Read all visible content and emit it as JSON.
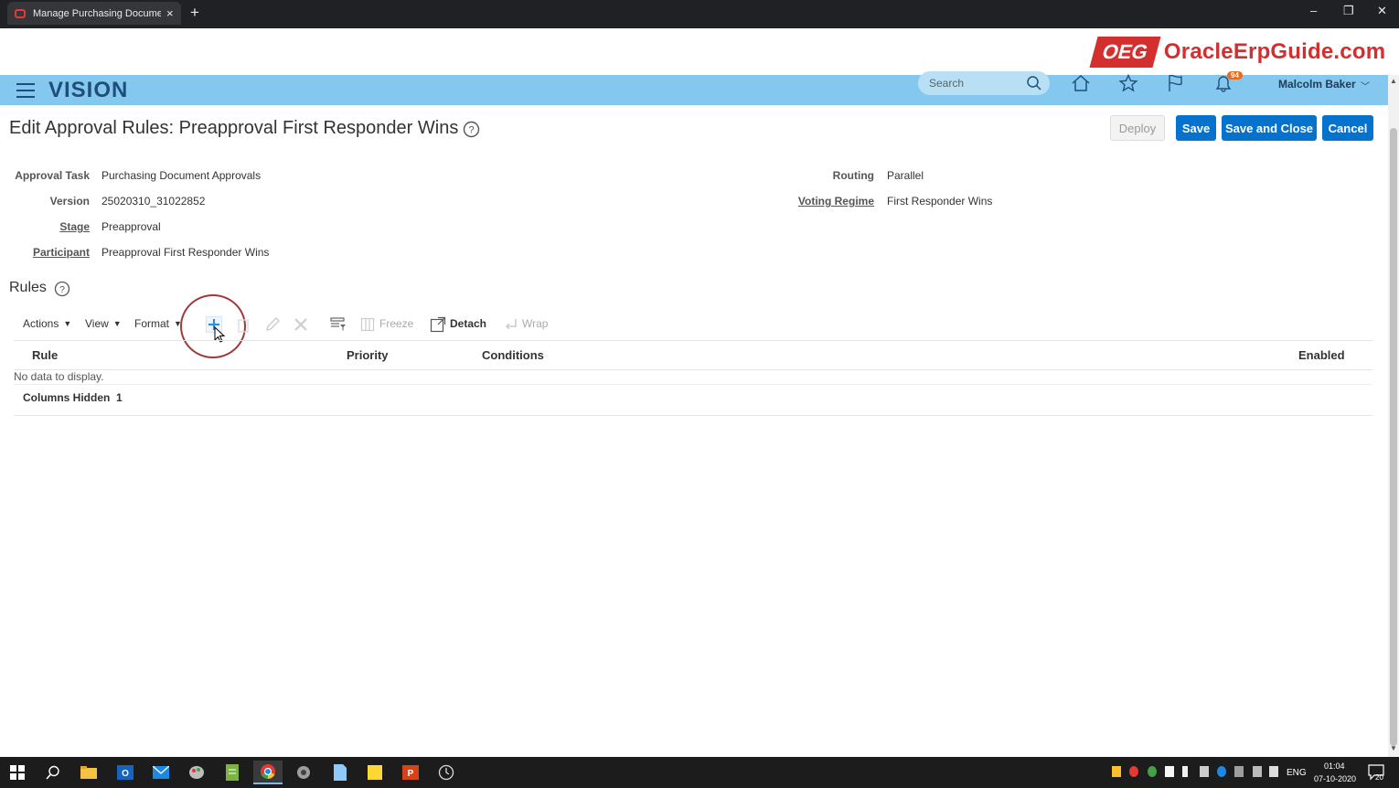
{
  "browser": {
    "tab_title": "Manage Purchasing Document A",
    "new_tab": "+",
    "close": "×",
    "minimize": "–",
    "restore": "❐",
    "window_close": "✕"
  },
  "brand": {
    "box": "OEG",
    "text": "OracleErpGuide.com"
  },
  "header": {
    "logo": "VISION",
    "search_placeholder": "Search",
    "notification_count": "94",
    "user_name": "Malcolm Baker"
  },
  "page": {
    "title": "Edit Approval Rules: Preapproval First Responder Wins",
    "buttons": {
      "deploy": "Deploy",
      "save": "Save",
      "save_close": "Save and Close",
      "cancel": "Cancel"
    }
  },
  "form": {
    "approval_task": {
      "label": "Approval Task",
      "value": "Purchasing Document Approvals"
    },
    "version": {
      "label": "Version",
      "value": "25020310_31022852"
    },
    "stage": {
      "label": "Stage",
      "value": "Preapproval"
    },
    "participant": {
      "label": "Participant",
      "value": "Preapproval First Responder Wins"
    },
    "routing": {
      "label": "Routing",
      "value": "Parallel"
    },
    "voting_regime": {
      "label": "Voting Regime",
      "value": "First Responder Wins"
    }
  },
  "rules": {
    "section_title": "Rules",
    "toolbar": {
      "actions": "Actions",
      "view": "View",
      "format": "Format",
      "freeze": "Freeze",
      "detach": "Detach",
      "wrap": "Wrap"
    },
    "columns": [
      "Rule",
      "Priority",
      "Conditions",
      "Enabled"
    ],
    "empty_text": "No data to display.",
    "columns_hidden_label": "Columns Hidden",
    "columns_hidden_count": "1"
  },
  "taskbar": {
    "lang": "ENG",
    "time": "01:04",
    "date": "07-10-2020",
    "notification": "20"
  },
  "colors": {
    "header_bg": "#84c8f0",
    "primary_button": "#0572ce",
    "brand_red": "#d32f2f"
  }
}
